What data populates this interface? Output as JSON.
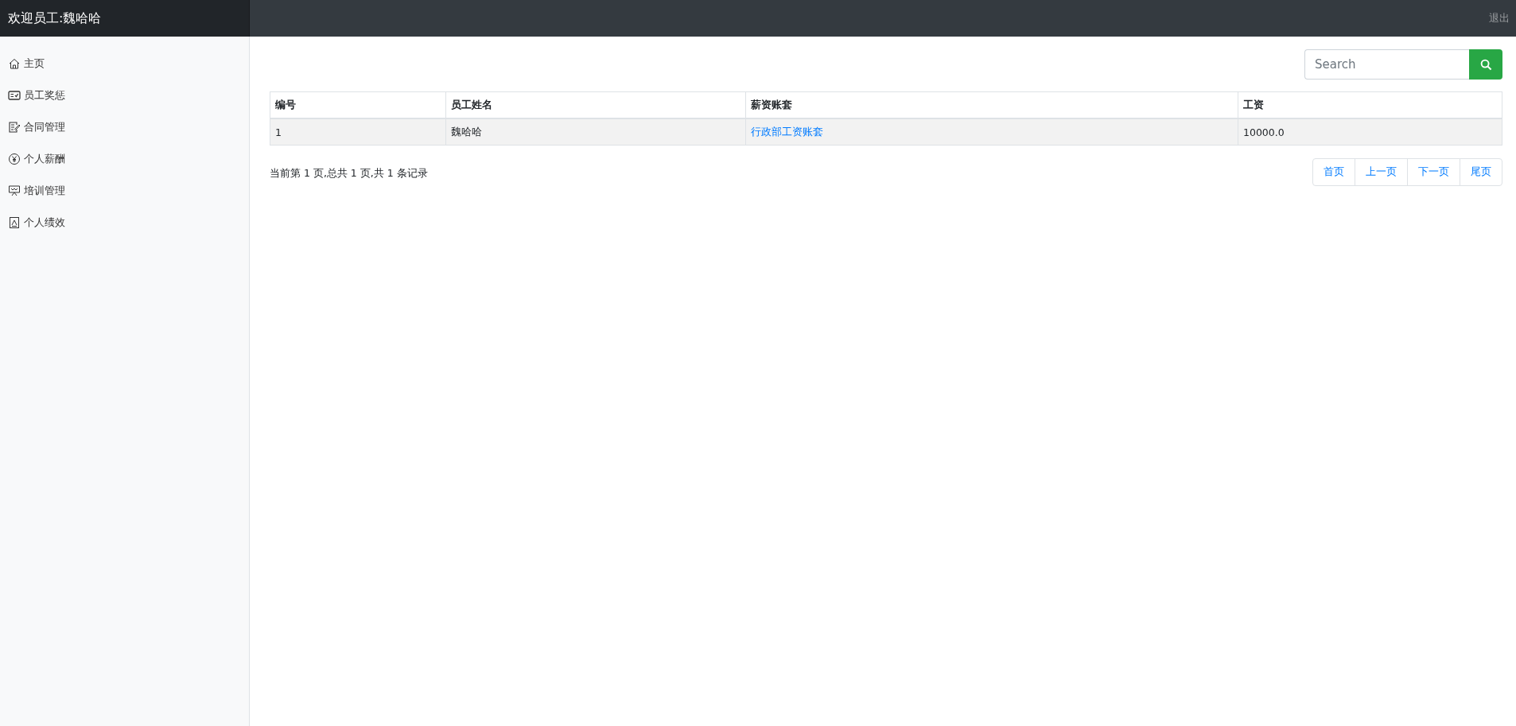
{
  "header": {
    "title": "欢迎员工:魏哈哈",
    "logout": "退出"
  },
  "sidebar": {
    "items": [
      {
        "label": "主页",
        "kind": "home"
      },
      {
        "label": "员工奖惩",
        "kind": "board"
      },
      {
        "label": "合同管理",
        "kind": "doc"
      },
      {
        "label": "个人薪酬",
        "kind": "yen"
      },
      {
        "label": "培训管理",
        "kind": "teach"
      },
      {
        "label": "个人绩效",
        "kind": "perf"
      }
    ]
  },
  "search": {
    "placeholder": "Search"
  },
  "table": {
    "columns": [
      "编号",
      "员工姓名",
      "薪资账套",
      "工资"
    ],
    "rows": [
      {
        "cells": [
          {
            "text": "1",
            "kind": "text"
          },
          {
            "text": "魏哈哈",
            "kind": "text"
          },
          {
            "text": "行政部工资账套",
            "kind": "link"
          },
          {
            "text": "10000.0",
            "kind": "text"
          }
        ]
      }
    ]
  },
  "page_info": "当前第 1 页,总共 1 页,共 1 条记录",
  "pagination": [
    "首页",
    "上一页",
    "下一页",
    "尾页"
  ]
}
